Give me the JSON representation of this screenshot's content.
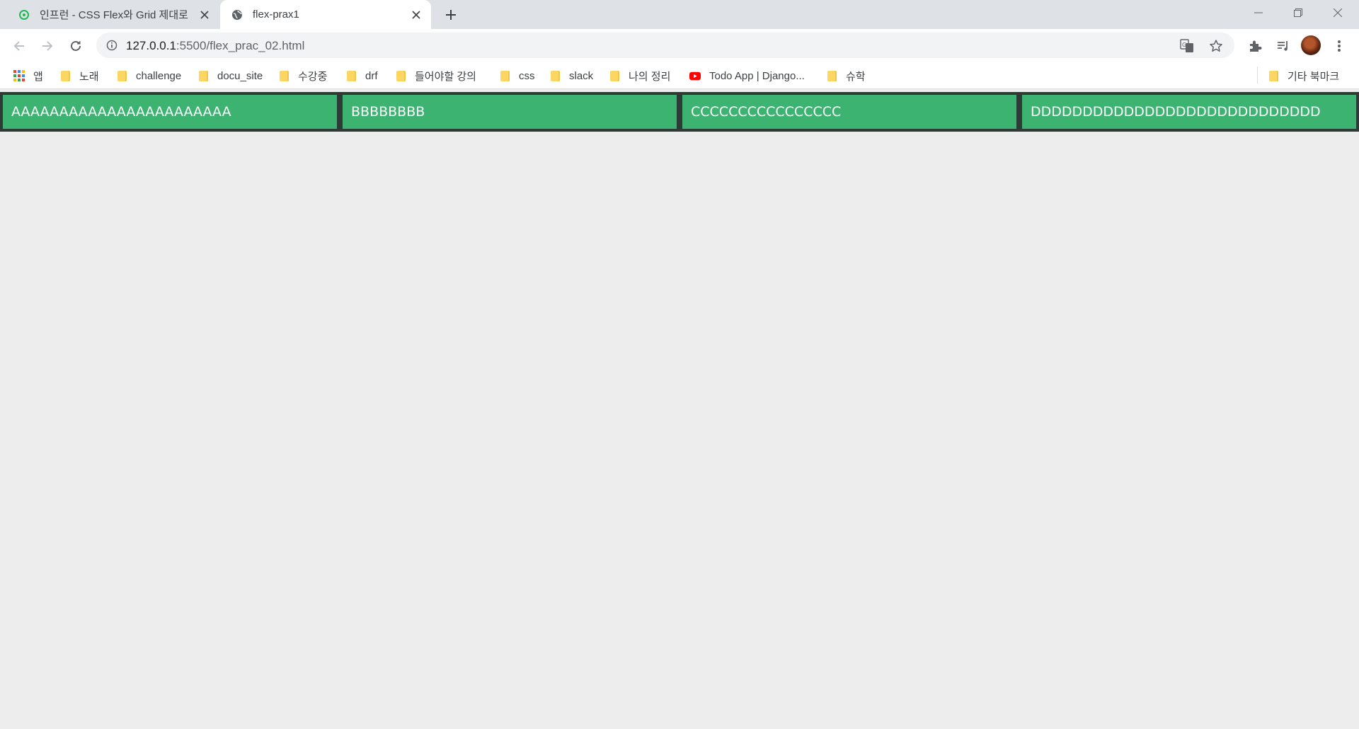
{
  "browser": {
    "tabs": [
      {
        "title": "인프런 - CSS Flex와 Grid 제대로",
        "icon": "inflearn-icon",
        "active": false
      },
      {
        "title": "flex-prax1",
        "icon": "globe-icon",
        "active": true
      }
    ],
    "address": {
      "host": "127.0.0.1",
      "rest": ":5500/flex_prac_02.html"
    }
  },
  "bookmarks": {
    "apps_label": "앱",
    "items": [
      {
        "label": "노래",
        "icon": "folder-icon"
      },
      {
        "label": "challenge",
        "icon": "folder-icon"
      },
      {
        "label": "docu_site",
        "icon": "folder-icon"
      },
      {
        "label": "수강중",
        "icon": "folder-icon"
      },
      {
        "label": "drf",
        "icon": "folder-icon"
      },
      {
        "label": "들어야할 강의",
        "icon": "folder-icon"
      },
      {
        "label": "css",
        "icon": "folder-icon"
      },
      {
        "label": "slack",
        "icon": "folder-icon"
      },
      {
        "label": "나의 정리",
        "icon": "folder-icon"
      },
      {
        "label": "Todo App | Django...",
        "icon": "youtube-icon"
      },
      {
        "label": "슈학",
        "icon": "folder-icon"
      }
    ],
    "other_label": "기타 북마크"
  },
  "page": {
    "items": [
      "AAAAAAAAAAAAAAAAAAAAAAA",
      "BBBBBBBB",
      "CCCCCCCCCCCCCCCC",
      "DDDDDDDDDDDDDDDDDDDDDDDDDDDD"
    ],
    "colors": {
      "item_bg": "#3cb371",
      "container_bg": "#2e3a35",
      "page_bg": "#ededed"
    }
  }
}
